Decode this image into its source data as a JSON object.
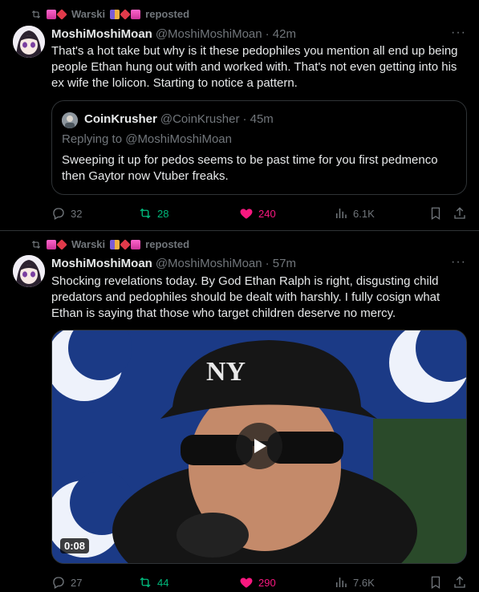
{
  "tweets": [
    {
      "repost_name": "Warski",
      "repost_suffix": "reposted",
      "author_name": "MoshiMoshiMoan",
      "author_handle": "@MoshiMoshiMoan",
      "time": "· 42m",
      "more": "···",
      "text": "That's a hot take but why is it these pedophiles you mention all end up being people Ethan hung out with and worked with.  That's not even getting into his ex wife the lolicon.  Starting to notice a pattern.",
      "quote": {
        "author_name": "CoinKrusher",
        "author_handle": "@CoinKrusher",
        "time": "· 45m",
        "replying_to": "Replying to @MoshiMoshiMoan",
        "text": "Sweeping it up for pedos seems to be past time for you first pedmenco then Gaytor now Vtuber freaks."
      },
      "stats": {
        "replies": "32",
        "reposts": "28",
        "likes": "240",
        "views": "6.1K"
      }
    },
    {
      "repost_name": "Warski",
      "repost_suffix": "reposted",
      "author_name": "MoshiMoshiMoan",
      "author_handle": "@MoshiMoshiMoan",
      "time": "· 57m",
      "more": "···",
      "text": "Shocking revelations today.  By God Ethan Ralph is right, disgusting child predators and pedophiles should be dealt with harshly.  I fully cosign what Ethan is saying that those who target children deserve no mercy.",
      "media": {
        "duration": "0:08",
        "cap_logo": "NY"
      },
      "stats": {
        "replies": "27",
        "reposts": "44",
        "likes": "290",
        "views": "7.6K"
      }
    }
  ],
  "colors": {
    "background": "#000000",
    "text": "#e7e9ea",
    "muted": "#71767b",
    "retweet": "#00ba7c",
    "like": "#f91880",
    "border": "#2f3336"
  },
  "icons": [
    "repost-icon",
    "reply-icon",
    "retweet-icon",
    "heart-icon",
    "views-icon",
    "bookmark-icon",
    "share-icon",
    "play-icon",
    "more-icon"
  ]
}
